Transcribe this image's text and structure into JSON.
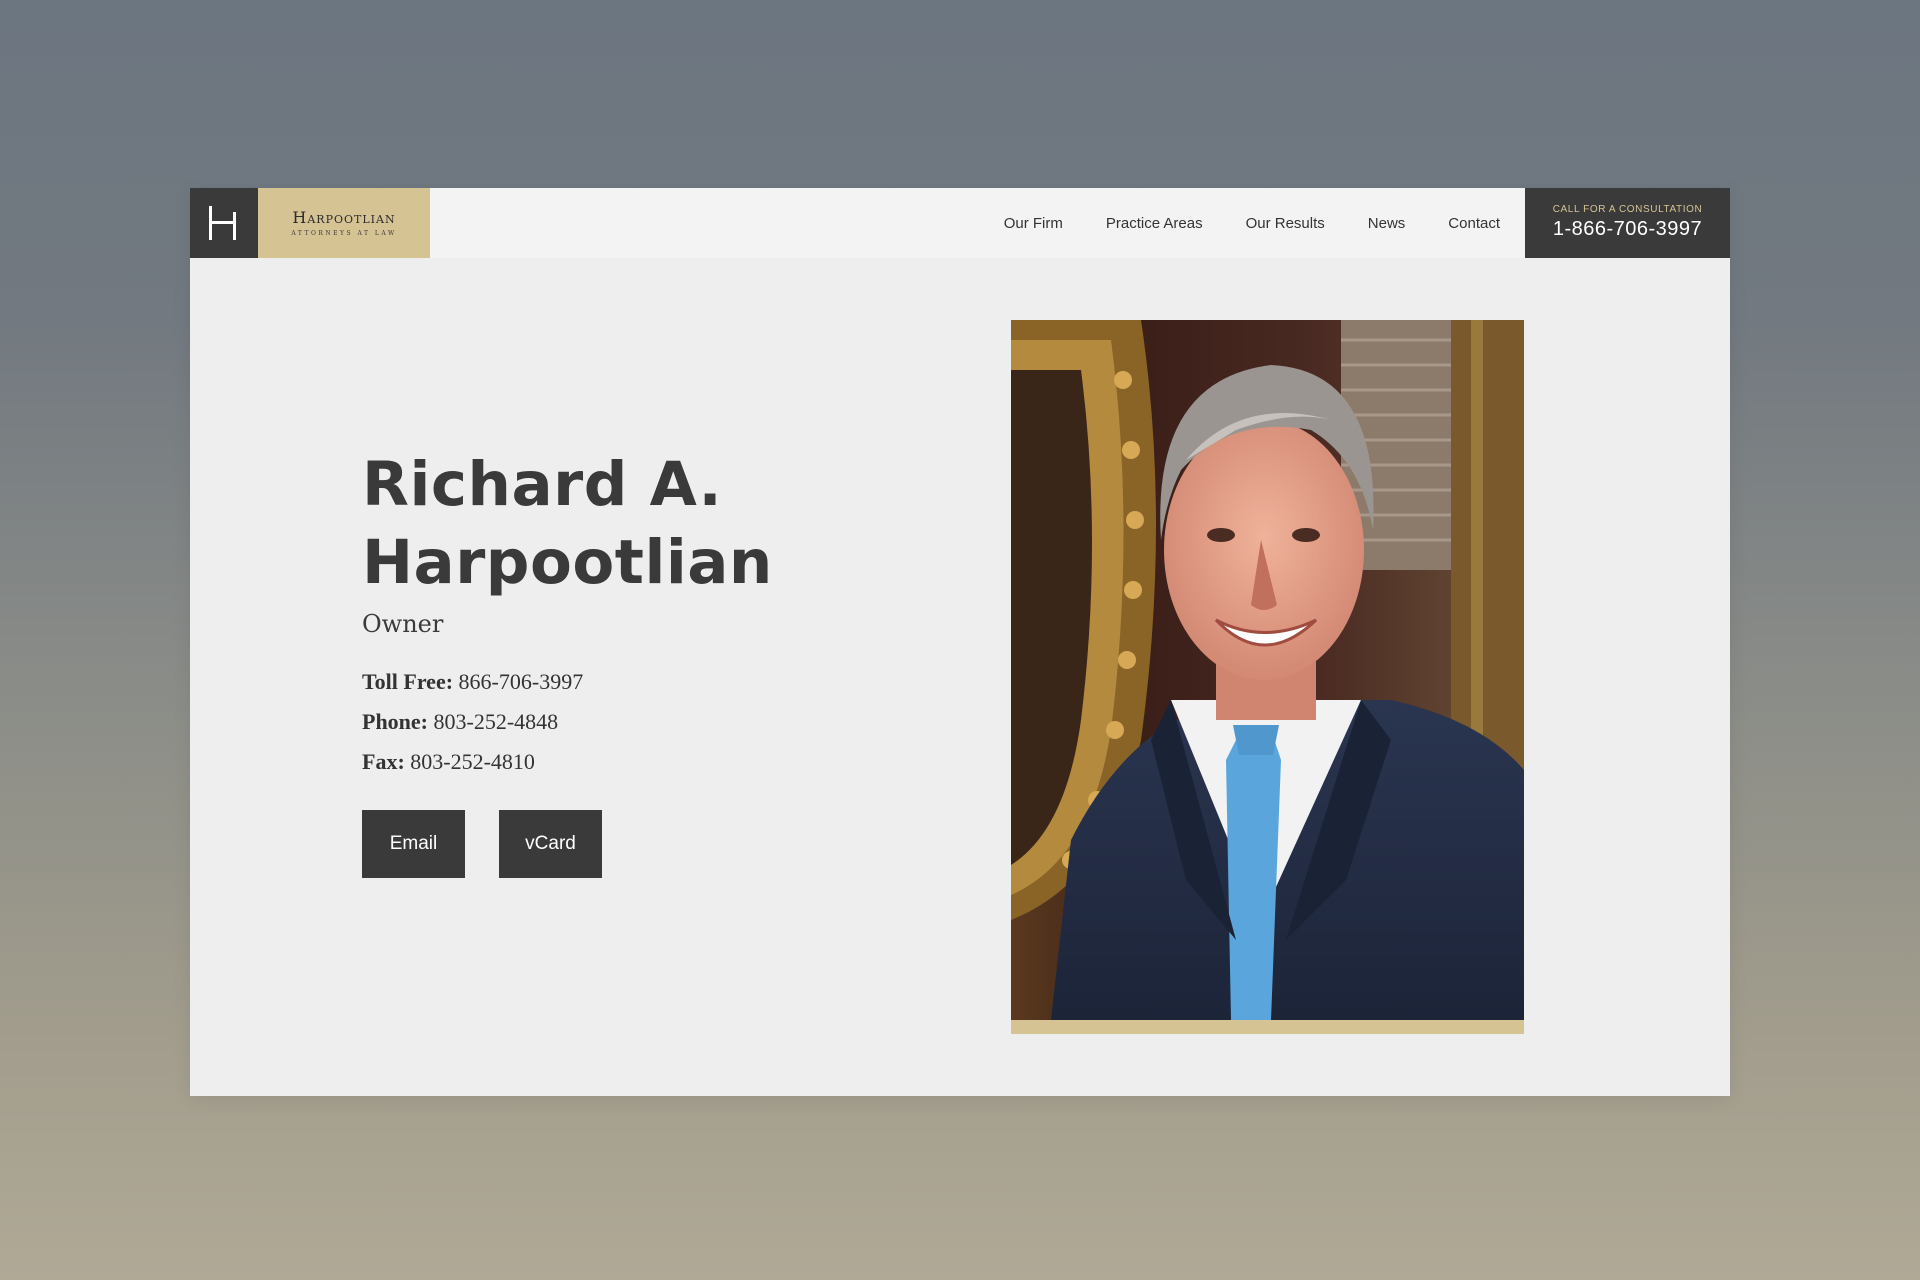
{
  "brand": {
    "monogram": "H",
    "name": "Harpootlian",
    "tagline": "Attorneys at Law",
    "accent_color": "#d6c394",
    "dark_color": "#3a3a3a"
  },
  "nav": {
    "items": [
      {
        "label": "Our Firm"
      },
      {
        "label": "Practice Areas"
      },
      {
        "label": "Our Results"
      },
      {
        "label": "News"
      },
      {
        "label": "Contact"
      }
    ]
  },
  "cta": {
    "label": "Call for a consultation",
    "phone": "1-866-706-3997"
  },
  "profile": {
    "name_line1": "Richard A.",
    "name_line2": "Harpootlian",
    "role": "Owner",
    "contacts": [
      {
        "label": "Toll Free:",
        "value": "866-706-3997"
      },
      {
        "label": "Phone:",
        "value": "803-252-4848"
      },
      {
        "label": "Fax:",
        "value": "803-252-4810"
      }
    ],
    "buttons": {
      "email": "Email",
      "vcard": "vCard"
    }
  }
}
